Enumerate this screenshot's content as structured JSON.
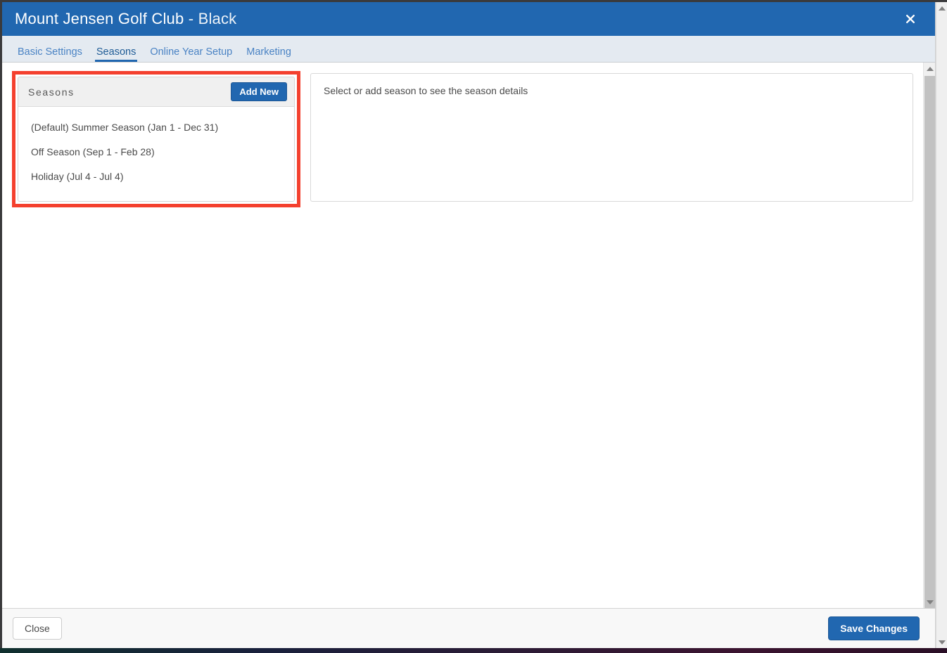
{
  "window": {
    "title_main": "Mount Jensen Golf Club",
    "title_separator": " - ",
    "title_suffix": "Black",
    "close_icon": "close-icon",
    "accent_color": "#2167b0",
    "titlebar_color": "#2167b0",
    "tabbar_color": "#e4eaf1",
    "highlight_color": "#f4402e"
  },
  "tabs": [
    {
      "label": "Basic Settings",
      "active": false
    },
    {
      "label": "Seasons",
      "active": true
    },
    {
      "label": "Online Year Setup",
      "active": false
    },
    {
      "label": "Marketing",
      "active": false
    }
  ],
  "seasons_panel": {
    "header_title": "Seasons",
    "add_new_label": "Add New",
    "items": [
      {
        "label": "(Default) Summer Season (Jan 1 - Dec 31)"
      },
      {
        "label": "Off Season (Sep 1 - Feb 28)"
      },
      {
        "label": "Holiday (Jul 4 - Jul 4)"
      }
    ]
  },
  "details_panel": {
    "placeholder": "Select or add season to see the season details"
  },
  "footer": {
    "close_label": "Close",
    "save_label": "Save Changes"
  },
  "scrollbars": {
    "inner_up_icon": "scroll-up-arrow-icon",
    "inner_down_icon": "scroll-down-arrow-icon",
    "outer_up_icon": "scroll-up-arrow-icon",
    "outer_down_icon": "scroll-down-arrow-icon"
  }
}
